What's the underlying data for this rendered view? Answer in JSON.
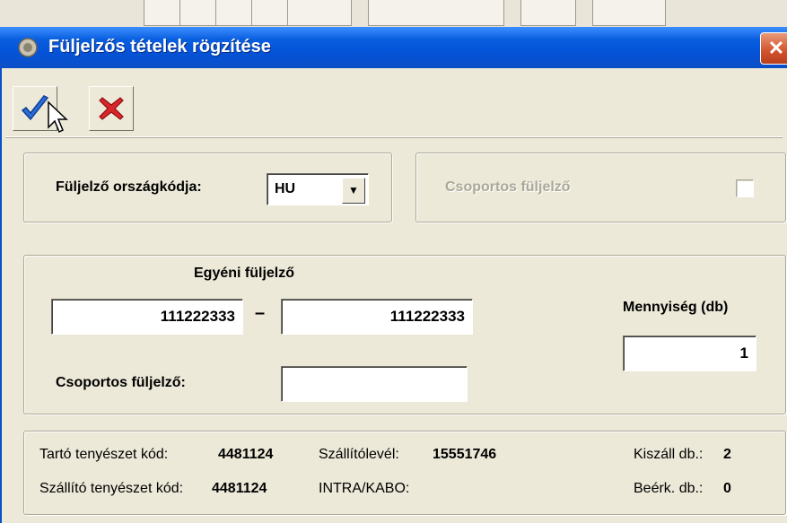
{
  "window": {
    "title": "Füljelzős tételek rögzítése",
    "close_symbol": "✕"
  },
  "toolbar": {
    "ok_icon": "checkmark-icon",
    "cancel_icon": "red-x-icon"
  },
  "country": {
    "label": "Füljelző országkódja:",
    "value": "HU"
  },
  "group_box": {
    "label": "Csoportos füljelző",
    "checked": false
  },
  "ear_tag": {
    "heading": "Egyéni füljelző",
    "from": "111222333",
    "separator": "–",
    "to": "111222333",
    "quantity_label": "Mennyiség (db)",
    "quantity": "1",
    "group_label": "Csoportos füljelző:",
    "group_value": ""
  },
  "info": {
    "keeper_label": "Tartó tenyészet kód:",
    "keeper_value": "4481124",
    "waybill_label": "Szállítólevél:",
    "waybill_value": "15551746",
    "shipped_label": "Kiszáll db.:",
    "shipped_value": "2",
    "supplier_label": "Szállító tenyészet kód:",
    "supplier_value": "4481124",
    "intra_label": "INTRA/KABO:",
    "received_label": "Beérk. db.:",
    "received_value": "0"
  },
  "colors": {
    "titlebar": "#0453d8",
    "window_bg": "#ece9d8",
    "ok_blue": "#2b6fd6",
    "cancel_red": "#d9262b"
  }
}
